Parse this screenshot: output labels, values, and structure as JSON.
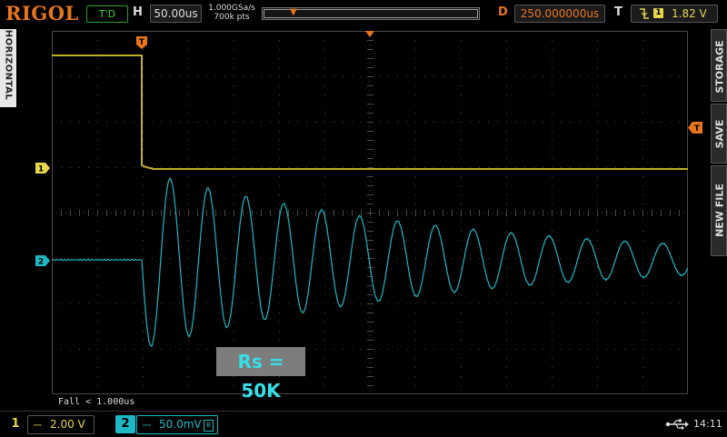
{
  "header": {
    "brand": "RIGOL",
    "run_status": "T'D",
    "horizontal_label": "H",
    "timebase": "50.00us",
    "sample_rate": "1.000GSa/s",
    "memory_depth": "700k pts",
    "delay_label": "D",
    "delay_value": "250.000000us",
    "trigger_label": "T",
    "trigger_source": "1",
    "trigger_level": "1.82 V"
  },
  "side_menu": {
    "left": "HORIZONTAL",
    "right": [
      "STORAGE",
      "SAVE",
      "NEW FILE"
    ]
  },
  "markers": {
    "trigger_top": "T",
    "trigger_right": "T",
    "ch1": "1",
    "ch2": "2"
  },
  "measurement": "Fall < 1.000us",
  "annotation": "Rs = 50K",
  "channels": [
    {
      "number": "1",
      "coupling": "DC",
      "scale": "2.00 V",
      "color": "#e6d84a"
    },
    {
      "number": "2",
      "coupling": "DC",
      "scale": "50.0mV",
      "color": "#1eb8c4"
    }
  ],
  "clock": "14:11",
  "colors": {
    "brand": "#e8751a",
    "ch1": "#bfae2a",
    "ch2": "#1eb8c4",
    "grid": "#4a4a4a",
    "status": "#3fd34a"
  },
  "icons": {
    "usb": "usb-icon",
    "trigger_edge": "falling-edge-icon",
    "bandwidth": "bandwidth-limit-icon"
  }
}
